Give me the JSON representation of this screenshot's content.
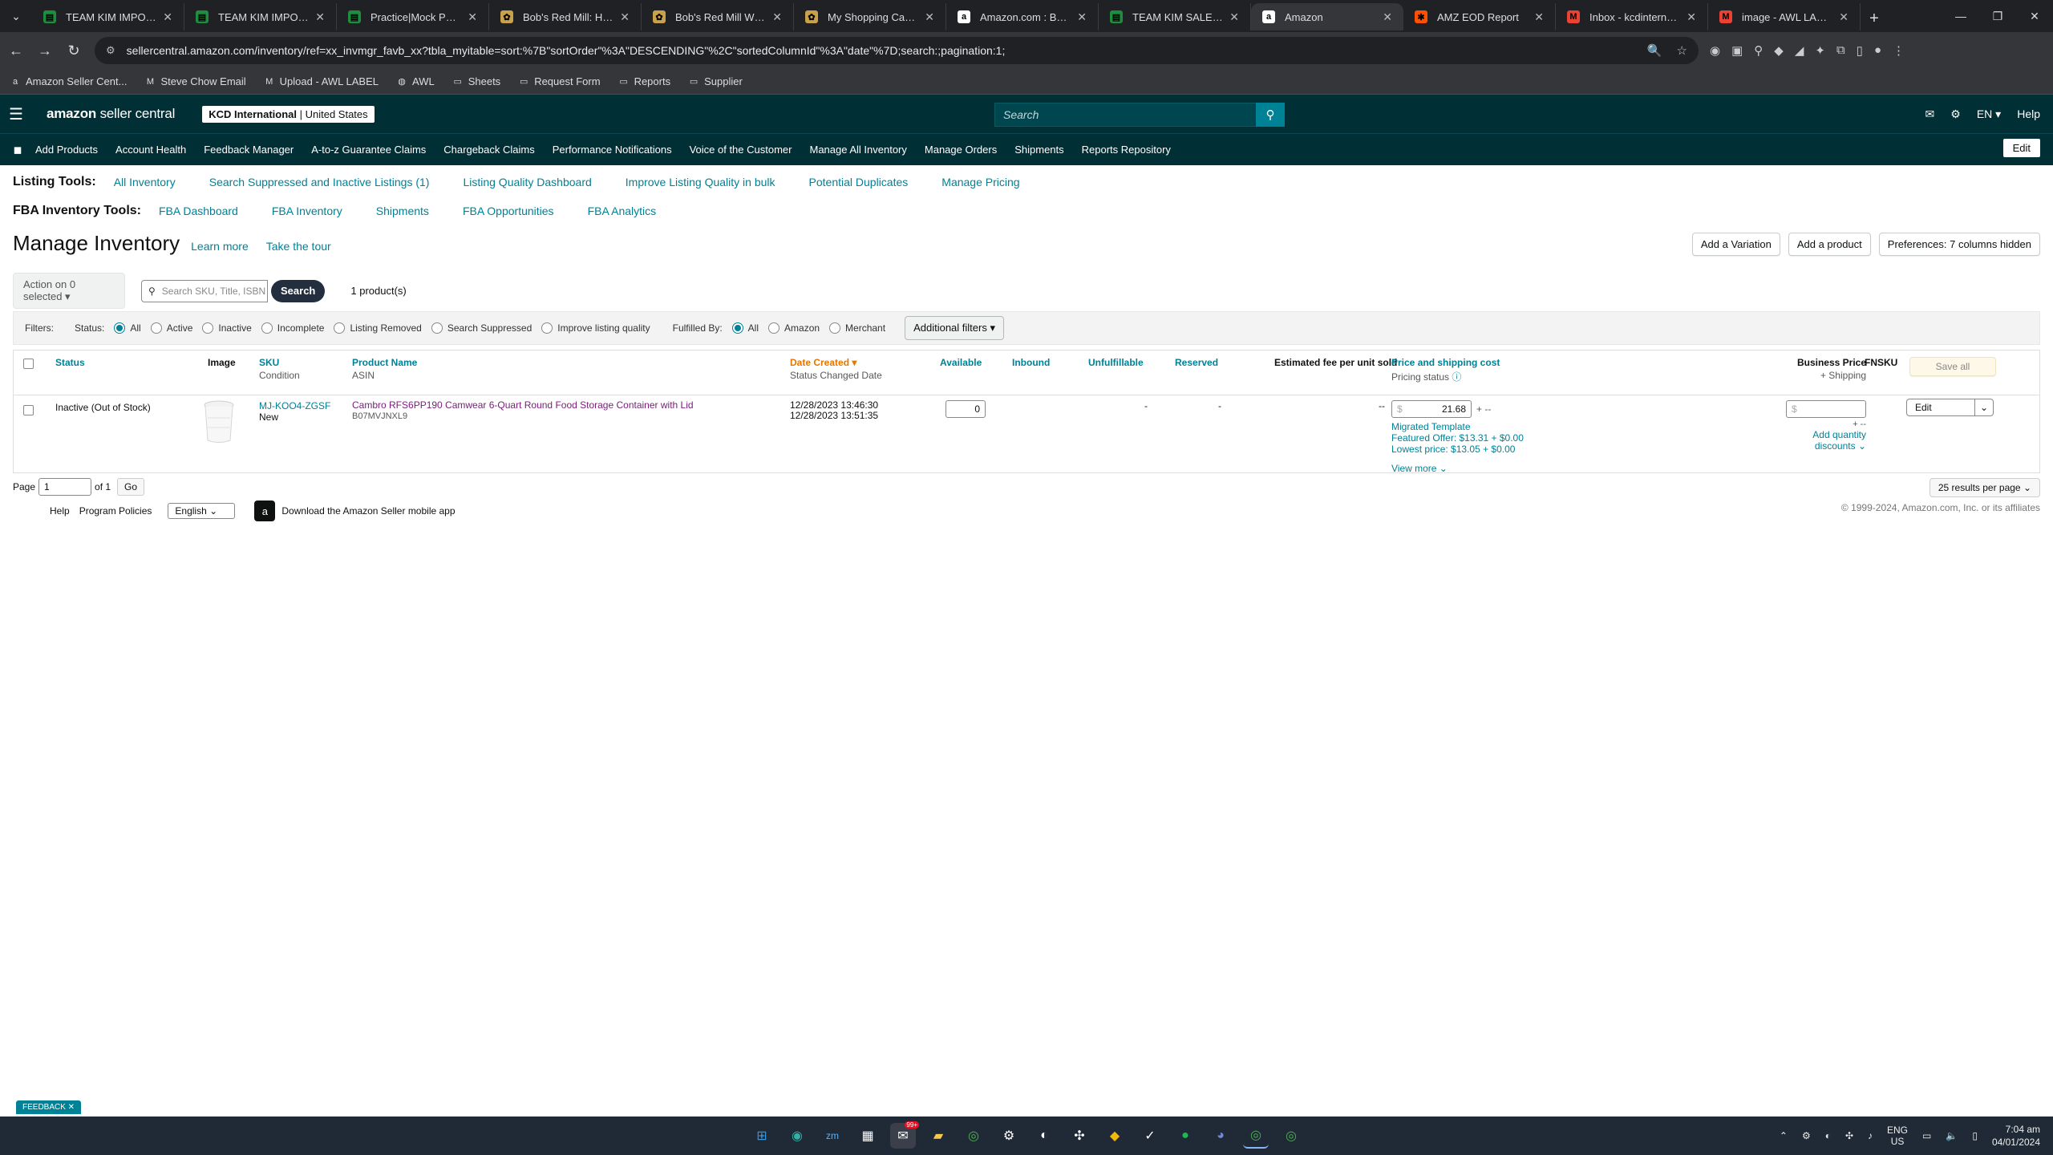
{
  "browser": {
    "tabs": [
      {
        "label": "TEAM KIM IMPORTANT",
        "icon": "sheets",
        "color": "#1e8e3e"
      },
      {
        "label": "TEAM KIM IMPORTANT",
        "icon": "sheets",
        "color": "#1e8e3e"
      },
      {
        "label": "Practice|Mock PR - Go",
        "icon": "sheets",
        "color": "#1e8e3e"
      },
      {
        "label": "Bob's Red Mill: Healthy",
        "icon": "bobs",
        "color": "#c8a24a"
      },
      {
        "label": "Bob's Red Mill Whole V",
        "icon": "bobs",
        "color": "#c8a24a"
      },
      {
        "label": "My Shopping Cart - Vi",
        "icon": "bobs",
        "color": "#c8a24a"
      },
      {
        "label": "Amazon.com : Bob's R",
        "icon": "amazon",
        "color": "#ffffff"
      },
      {
        "label": "TEAM KIM SALES MON",
        "icon": "sheets",
        "color": "#1e8e3e"
      },
      {
        "label": "Amazon",
        "icon": "amazon",
        "color": "#ffffff",
        "active": true
      },
      {
        "label": "AMZ EOD Report",
        "icon": "zapier",
        "color": "#ff4f00"
      },
      {
        "label": "Inbox - kcdinternation",
        "icon": "gmail",
        "color": "#ea4335"
      },
      {
        "label": "image - AWL LABEL",
        "icon": "gmail",
        "color": "#ea4335"
      }
    ],
    "url": "sellercentral.amazon.com/inventory/ref=xx_invmgr_favb_xx?tbla_myitable=sort:%7B\"sortOrder\"%3A\"DESCENDING\"%2C\"sortedColumnId\"%3A\"date\"%7D;search:;pagination:1;",
    "bookmarks": [
      {
        "label": "Amazon Seller Cent...",
        "icon": "amazon-icon"
      },
      {
        "label": "Steve Chow Email",
        "icon": "gmail-icon"
      },
      {
        "label": "Upload - AWL LABEL",
        "icon": "gmail-icon"
      },
      {
        "label": "AWL",
        "icon": "globe-icon"
      },
      {
        "label": "Sheets",
        "icon": "folder-icon"
      },
      {
        "label": "Request Form",
        "icon": "folder-icon"
      },
      {
        "label": "Reports",
        "icon": "folder-icon"
      },
      {
        "label": "Supplier",
        "icon": "folder-icon"
      }
    ]
  },
  "header": {
    "logo_bold": "amazon",
    "logo_rest": " seller central",
    "account_bold": "KCD International",
    "account_sep": " | ",
    "account_region": "United States",
    "search_placeholder": "Search",
    "language": "EN",
    "help": "Help"
  },
  "nav": {
    "items": [
      "Add Products",
      "Account Health",
      "Feedback Manager",
      "A-to-z Guarantee Claims",
      "Chargeback Claims",
      "Performance Notifications",
      "Voice of the Customer",
      "Manage All Inventory",
      "Manage Orders",
      "Shipments",
      "Reports Repository"
    ],
    "edit": "Edit"
  },
  "listing_tools": {
    "label": "Listing Tools:",
    "links": [
      "All Inventory",
      "Search Suppressed and Inactive Listings (1)",
      "Listing Quality Dashboard",
      "Improve Listing Quality in bulk",
      "Potential Duplicates",
      "Manage Pricing"
    ]
  },
  "fba_tools": {
    "label": "FBA Inventory Tools:",
    "links": [
      "FBA Dashboard",
      "FBA Inventory",
      "Shipments",
      "FBA Opportunities",
      "FBA Analytics"
    ]
  },
  "page": {
    "title": "Manage Inventory",
    "learn_more": "Learn more",
    "tour": "Take the tour",
    "buttons": {
      "variation": "Add a Variation",
      "product": "Add a product",
      "preferences": "Preferences: 7 columns hidden"
    },
    "action": "Action on 0 selected",
    "search_placeholder": "Search SKU, Title, ISBN",
    "search_btn": "Search",
    "count": "1 product(s)"
  },
  "filters": {
    "label": "Filters:",
    "status_label": "Status:",
    "status_options": [
      "All",
      "Active",
      "Inactive",
      "Incomplete",
      "Listing Removed",
      "Search Suppressed",
      "Improve listing quality"
    ],
    "fulfilled_label": "Fulfilled By:",
    "fulfilled_options": [
      "All",
      "Amazon",
      "Merchant"
    ],
    "additional": "Additional filters"
  },
  "table": {
    "headers": {
      "status": "Status",
      "image": "Image",
      "sku": "SKU",
      "condition": "Condition",
      "product": "Product Name",
      "asin": "ASIN",
      "date": "Date Created",
      "date_sub": "Status Changed Date",
      "available": "Available",
      "inbound": "Inbound",
      "unfulfillable": "Unfulfillable",
      "reserved": "Reserved",
      "fee": "Estimated fee per unit sold",
      "price": "Price and shipping cost",
      "price_sub": "Pricing status",
      "biz": "Business Price",
      "biz_sub": "+ Shipping",
      "fnsku": "FNSKU",
      "save_all": "Save all"
    },
    "row": {
      "status": "Inactive (Out of Stock)",
      "sku": "MJ-KOO4-ZGSF",
      "condition": "New",
      "product": "Cambro RFS6PP190 Camwear 6-Quart Round Food Storage Container with Lid",
      "asin": "B07MVJNXL9",
      "date_created": "12/28/2023 13:46:30",
      "date_changed": "12/28/2023 13:51:35",
      "available": "0",
      "unfulfillable": "-",
      "reserved": "-",
      "fee": "--",
      "price_symbol": "$",
      "price": "21.68",
      "price_extra": "+ --",
      "template": "Migrated Template",
      "featured": "Featured Offer: $13.31 + $0.00",
      "lowest": "Lowest price: $13.05 + $0.00",
      "view_more": "View more",
      "biz_symbol": "$",
      "biz_extra": "+ --",
      "quantity_discounts": "Add quantity discounts",
      "edit": "Edit"
    }
  },
  "pager": {
    "label": "Page",
    "value": "1",
    "of": "of 1",
    "go": "Go",
    "per_page": "25 results per page"
  },
  "footer": {
    "help": "Help",
    "policies": "Program Policies",
    "language": "English",
    "app": "Download the Amazon Seller mobile app",
    "copyright": "© 1999-2024, Amazon.com, Inc. or its affiliates"
  },
  "feedback": "FEEDBACK",
  "taskbar": {
    "lang": "ENG",
    "region": "US",
    "time": "7:04 am",
    "date": "04/01/2024",
    "badge": "99+"
  }
}
